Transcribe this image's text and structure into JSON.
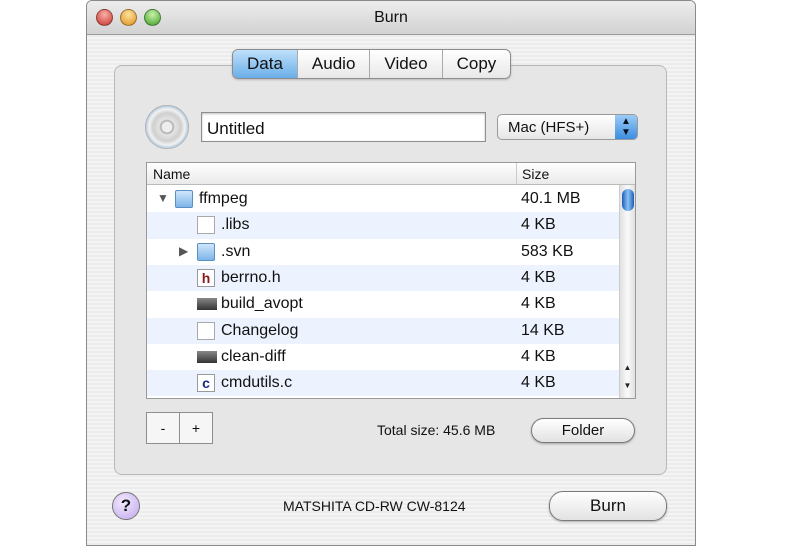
{
  "window": {
    "title": "Burn",
    "traffic_lights": {
      "close": "#d9534f",
      "minimize": "#f0ad32",
      "zoom": "#5cb85c"
    }
  },
  "tabs": [
    {
      "label": "Data",
      "active": true
    },
    {
      "label": "Audio"
    },
    {
      "label": "Video"
    },
    {
      "label": "Copy"
    }
  ],
  "disc_name": {
    "value": "Untitled"
  },
  "filesystem_select": {
    "value": "Mac (HFS+)"
  },
  "table": {
    "columns": [
      "Name",
      "Size"
    ],
    "rows": [
      {
        "name": "ffmpeg",
        "size": "40.1 MB",
        "icon": "folder-icon",
        "disclosure": "expanded",
        "level": 0
      },
      {
        "name": ".libs",
        "size": "4 KB",
        "icon": "document-icon",
        "level": 1
      },
      {
        "name": ".svn",
        "size": "583 KB",
        "icon": "folder-icon",
        "disclosure": "collapsed",
        "level": 1
      },
      {
        "name": "berrno.h",
        "size": "4 KB",
        "icon": "h-file-icon",
        "level": 1
      },
      {
        "name": "build_avopt",
        "size": "4 KB",
        "icon": "executable-icon",
        "level": 1
      },
      {
        "name": "Changelog",
        "size": "14 KB",
        "icon": "document-icon",
        "level": 1
      },
      {
        "name": "clean-diff",
        "size": "4 KB",
        "icon": "executable-icon",
        "level": 1
      },
      {
        "name": "cmdutils.c",
        "size": "4 KB",
        "icon": "c-file-icon",
        "level": 1
      }
    ]
  },
  "remove_label": "-",
  "add_label": "+",
  "total_size": "Total size: 45.6 MB",
  "folder_button": "Folder",
  "help_label": "?",
  "drive": "MATSHITA CD-RW CW-8124",
  "burn_button": "Burn"
}
